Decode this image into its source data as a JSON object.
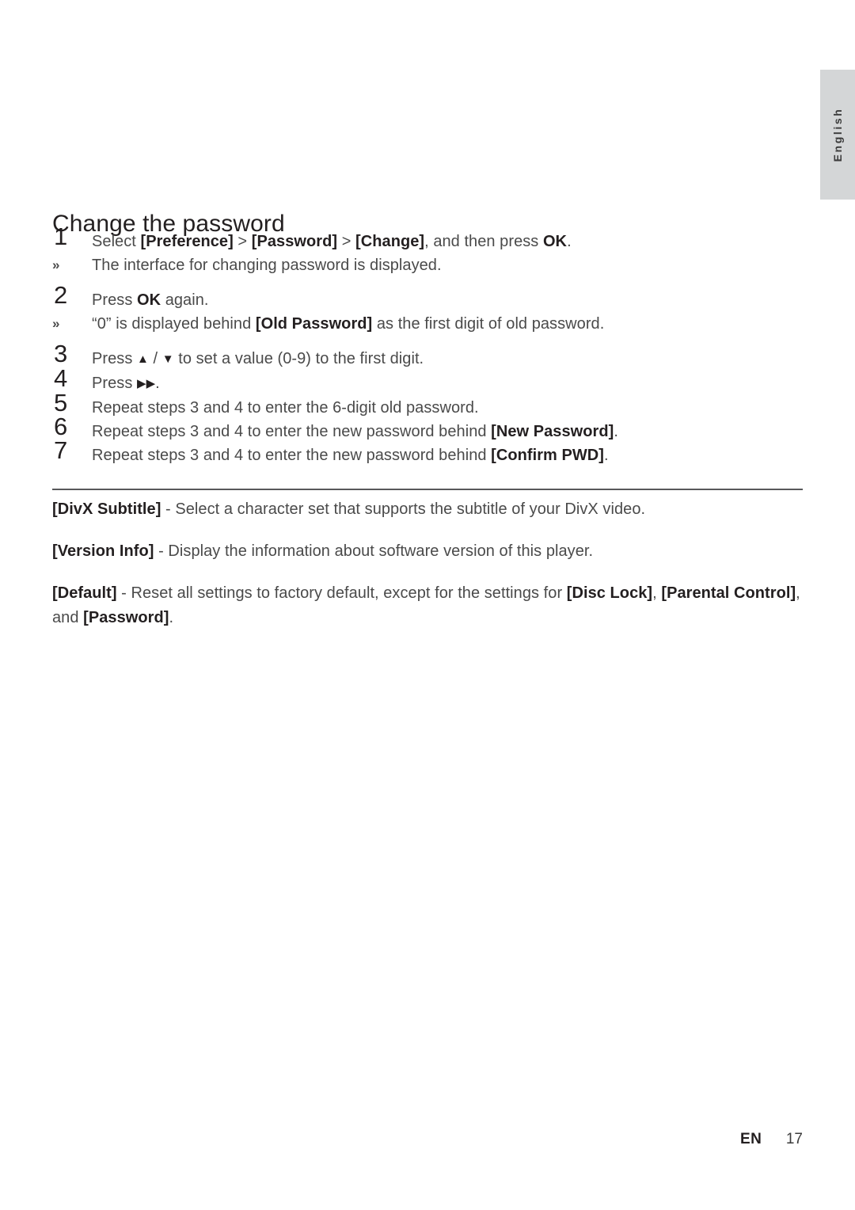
{
  "side_tab": {
    "language_label": "English"
  },
  "section": {
    "heading": "Change the password"
  },
  "steps": [
    {
      "number": "1",
      "text_html": "Select <b>[Preference]</b> > <b>[Password]</b> > <b>[Change]</b>, and then press <b>OK</b>.",
      "substep": {
        "marker": "»",
        "text_html": "The interface for changing password is displayed."
      }
    },
    {
      "number": "2",
      "text_html": "Press <b>OK</b> again.",
      "substep": {
        "marker": "»",
        "text_html": "“0” is displayed behind <b>[Old Password]</b> as the first digit of old password."
      }
    },
    {
      "number": "3",
      "text_html": "Press <span class=\"glyph\">▲</span> / <span class=\"glyph\">▼</span> to set a value (0-9) to the first digit.",
      "substep": null
    },
    {
      "number": "4",
      "text_html": "Press <span class=\"glyph\">▶▶</span>.",
      "substep": null
    },
    {
      "number": "5",
      "text_html": "Repeat steps 3 and 4 to enter the 6-digit old password.",
      "substep": null
    },
    {
      "number": "6",
      "text_html": "Repeat steps 3 and 4 to enter the new password behind <b>[New Password]</b>.",
      "substep": null
    },
    {
      "number": "7",
      "text_html": "Repeat steps 3 and 4 to enter the new password behind <b>[Confirm PWD]</b>.",
      "substep": null
    }
  ],
  "paragraphs": [
    "<b>[DivX Subtitle]</b> - Select a character set that supports the subtitle of your DivX video.",
    "<b>[Version Info]</b> - Display the information about software version of this player.",
    "<b>[Default]</b> - Reset all settings to factory default, except for the settings for <b>[Disc Lock]</b>, <b>[Parental Control]</b>, and <b>[Password]</b>."
  ],
  "footer": {
    "language_code": "EN",
    "page_number": "17"
  },
  "colors": {
    "tab_background": "#d4d6d7",
    "body_text": "#4a4a4a",
    "emphasis_text": "#231f20",
    "divider": "#58595b"
  }
}
